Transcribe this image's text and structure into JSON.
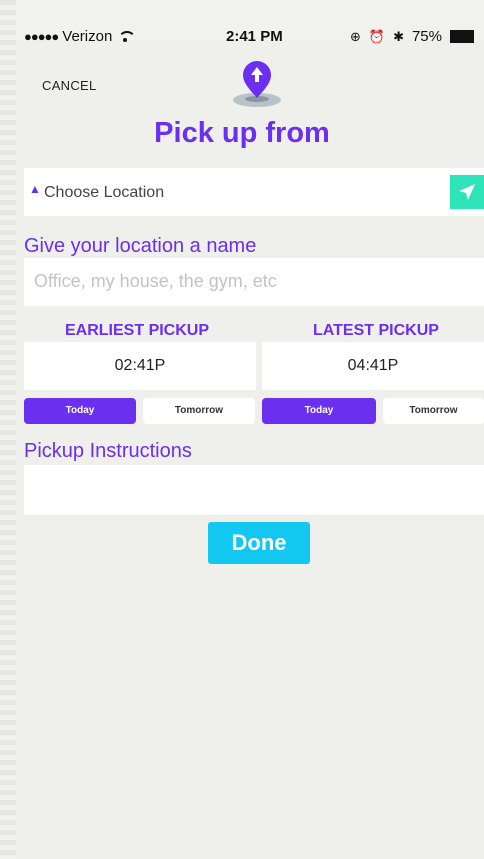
{
  "status_bar": {
    "signal": "●●●●●",
    "carrier": "Verizon",
    "time": "2:41 PM",
    "battery": "75%"
  },
  "header": {
    "cancel_label": "CANCEL",
    "title": "Pick up from"
  },
  "location": {
    "label": "Choose Location"
  },
  "name_section": {
    "label": "Give your location a name",
    "placeholder": "Office, my house, the gym, etc",
    "value": ""
  },
  "earliest": {
    "header": "EARLIEST PICKUP",
    "time": "02:41P",
    "today_label": "Today",
    "tomorrow_label": "Tomorrow",
    "selected": "Today"
  },
  "latest": {
    "header": "LATEST PICKUP",
    "time": "04:41P",
    "today_label": "Today",
    "tomorrow_label": "Tomorrow",
    "selected": "Today"
  },
  "instructions": {
    "label": "Pickup Instructions",
    "value": ""
  },
  "done_label": "Done",
  "colors": {
    "accent_purple": "#6b2ff0",
    "nav_green": "#2fe3b8",
    "done_blue": "#13c8f0",
    "background": "#efefec"
  }
}
